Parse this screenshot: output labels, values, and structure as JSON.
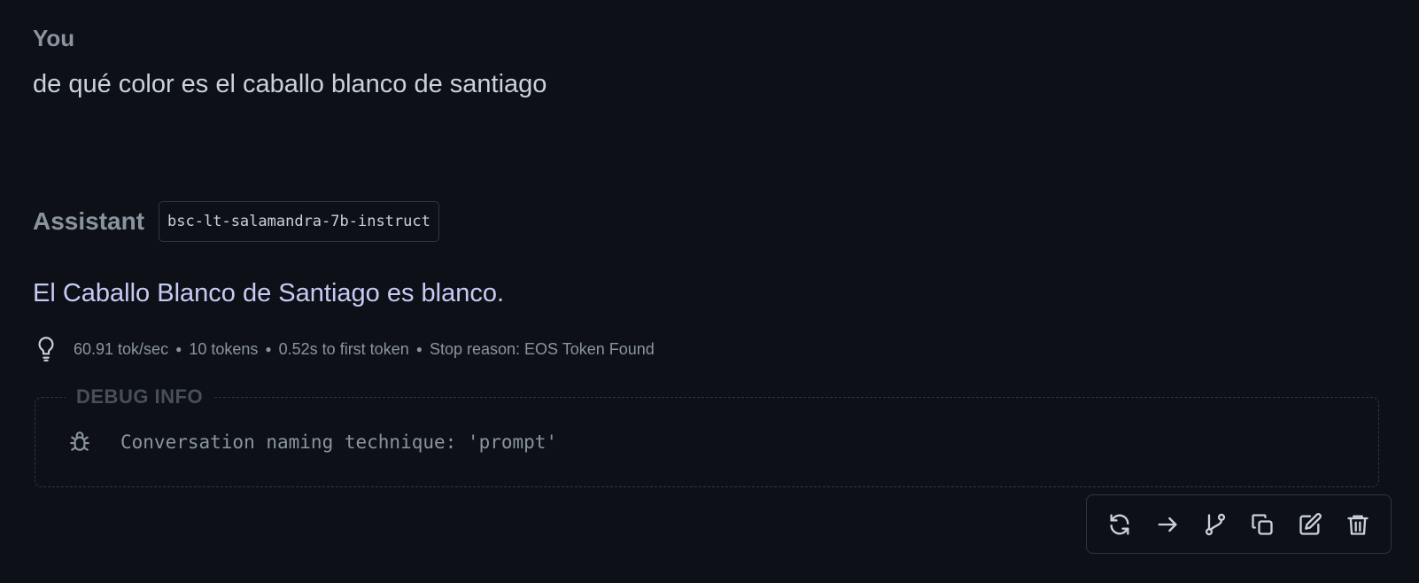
{
  "user": {
    "role_label": "You",
    "message": "de qué color es el caballo blanco de santiago"
  },
  "assistant": {
    "role_label": "Assistant",
    "model": "bsc-lt-salamandra-7b-instruct",
    "message": "El Caballo Blanco de Santiago es blanco.",
    "stats": {
      "speed": "60.91 tok/sec",
      "tokens": "10 tokens",
      "first_token": "0.52s to first token",
      "stop_reason": "Stop reason: EOS Token Found"
    }
  },
  "debug": {
    "legend": "DEBUG INFO",
    "text": "Conversation naming technique: 'prompt'"
  },
  "toolbar": {
    "icons": [
      "regenerate-icon",
      "continue-arrow-icon",
      "branch-icon",
      "copy-icon",
      "edit-icon",
      "delete-icon"
    ]
  },
  "colors": {
    "background": "#0d1117",
    "assistant_text": "#c6cbf5",
    "muted": "#8b949e",
    "border": "#30363d"
  }
}
